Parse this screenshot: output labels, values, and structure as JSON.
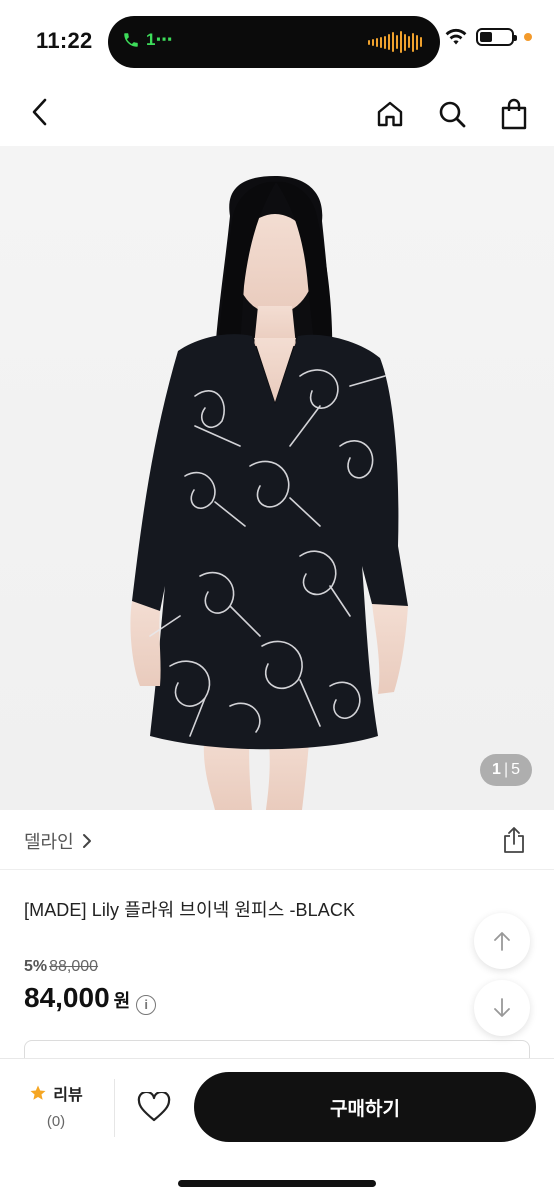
{
  "status_bar": {
    "time": "11:22",
    "call_label": "1⋯",
    "battery_level": 0.4
  },
  "nav": {
    "back_icon": "chevron-left-icon",
    "home_icon": "home-icon",
    "search_icon": "search-icon",
    "bag_icon": "shopping-bag-icon"
  },
  "product_image": {
    "current": "1",
    "separator": "|",
    "total": "5"
  },
  "brand": {
    "name": "델라인",
    "share_icon": "share-icon"
  },
  "product": {
    "title": "[MADE] Lily 플라워 브이넥 원피스 -BLACK",
    "discount_rate": "5%",
    "original_price": "88,000",
    "sale_price": "84,000",
    "currency": "원",
    "info_symbol": "i"
  },
  "bottom_bar": {
    "review_label": "리뷰",
    "review_count": "(0)",
    "buy_label": "구매하기"
  },
  "colors": {
    "accent": "#111111",
    "star": "#f5a623",
    "island_call": "#3ddc5a",
    "island_wave": "#f0a22e"
  }
}
